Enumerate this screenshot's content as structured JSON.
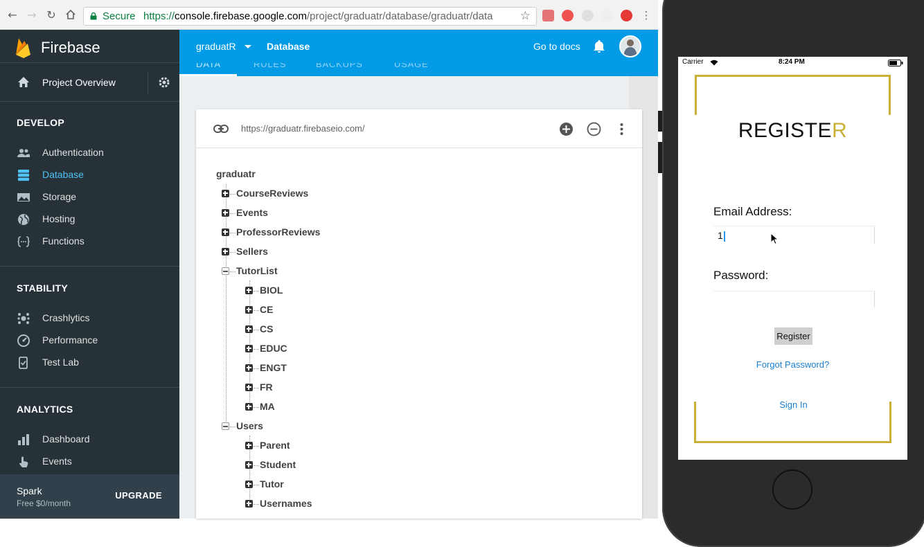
{
  "browser": {
    "secure_label": "Secure",
    "url_scheme": "https://",
    "url_host": "console.firebase.google.com",
    "url_path": "/project/graduatr/database/graduatr/data"
  },
  "sidebar": {
    "brand": "Firebase",
    "project_overview": "Project Overview",
    "sections": [
      {
        "title": "DEVELOP",
        "items": [
          "Authentication",
          "Database",
          "Storage",
          "Hosting",
          "Functions"
        ]
      },
      {
        "title": "STABILITY",
        "items": [
          "Crashlytics",
          "Performance",
          "Test Lab"
        ]
      },
      {
        "title": "ANALYTICS",
        "items": [
          "Dashboard",
          "Events"
        ]
      }
    ],
    "active_item": "Database",
    "plan": {
      "name": "Spark",
      "price": "Free $0/month",
      "upgrade": "UPGRADE"
    }
  },
  "topbar": {
    "project": "graduatR",
    "section": "Database",
    "docs": "Go to docs",
    "tabs": [
      "DATA",
      "RULES",
      "BACKUPS",
      "USAGE"
    ]
  },
  "database": {
    "url": "https://graduatr.firebaseio.com/",
    "root": "graduatr",
    "nodes": [
      {
        "name": "CourseReviews",
        "expanded": false
      },
      {
        "name": "Events",
        "expanded": false
      },
      {
        "name": "ProfessorReviews",
        "expanded": false
      },
      {
        "name": "Sellers",
        "expanded": false
      },
      {
        "name": "TutorList",
        "expanded": true,
        "children": [
          "BIOL",
          "CE",
          "CS",
          "EDUC",
          "ENGT",
          "FR",
          "MA"
        ]
      },
      {
        "name": "Users",
        "expanded": true,
        "children": [
          "Parent",
          "Student",
          "Tutor",
          "Usernames"
        ]
      }
    ]
  },
  "phone": {
    "carrier": "Carrier",
    "time": "8:24 PM",
    "title_main": "REGISTE",
    "title_accent": "R",
    "email_label": "Email Address:",
    "email_value": "1",
    "password_label": "Password:",
    "password_value": "",
    "register_label": "Register",
    "forgot_label": "Forgot Password?",
    "signin_label": "Sign In",
    "accent_color": "#c9b037"
  },
  "colors": {
    "firebase_blue": "#039be5",
    "sidebar_bg": "#263238",
    "active_link": "#4fc3f7",
    "secure_green": "#0b8043"
  }
}
